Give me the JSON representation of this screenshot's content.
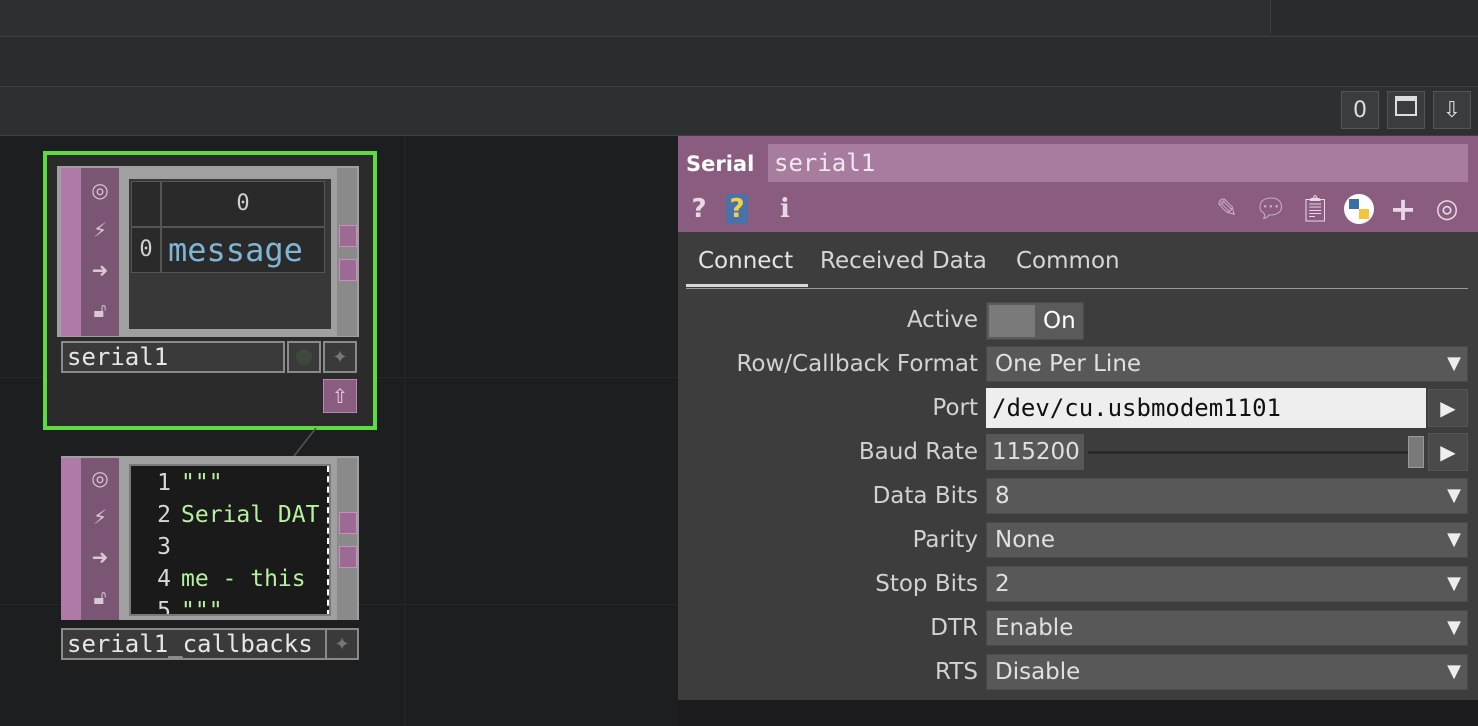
{
  "toolbar": {
    "counter": "0",
    "window_icon": "maximize-icon",
    "download_icon": "download-icon"
  },
  "nodes": {
    "serial1": {
      "name": "serial1",
      "table_header": "0",
      "row_index": "0",
      "row_value": "message"
    },
    "callbacks": {
      "name": "serial1_callbacks",
      "lines": [
        {
          "n": "1",
          "t": "\"\"\""
        },
        {
          "n": "2",
          "t": "Serial DAT"
        },
        {
          "n": "3",
          "t": ""
        },
        {
          "n": "4",
          "t": "me - this "
        },
        {
          "n": "5",
          "t": "\"\"\""
        }
      ]
    }
  },
  "panel": {
    "op_type": "Serial",
    "op_name": "serial1",
    "tabs": [
      "Connect",
      "Received Data",
      "Common"
    ],
    "active_label": "Active",
    "active_value": "On",
    "row_format_label": "Row/Callback Format",
    "row_format_value": "One Per Line",
    "port_label": "Port",
    "port_value": "/dev/cu.usbmodem1101",
    "baud_label": "Baud Rate",
    "baud_value": "115200",
    "data_bits_label": "Data Bits",
    "data_bits_value": "8",
    "parity_label": "Parity",
    "parity_value": "None",
    "stop_bits_label": "Stop Bits",
    "stop_bits_value": "2",
    "dtr_label": "DTR",
    "dtr_value": "Enable",
    "rts_label": "RTS",
    "rts_value": "Disable"
  },
  "colors": {
    "accent_green": "#5ddc3f",
    "dat_purple": "#8a5c80",
    "code_green": "#b6f0a0",
    "table_text_blue": "#7fb6d6"
  }
}
